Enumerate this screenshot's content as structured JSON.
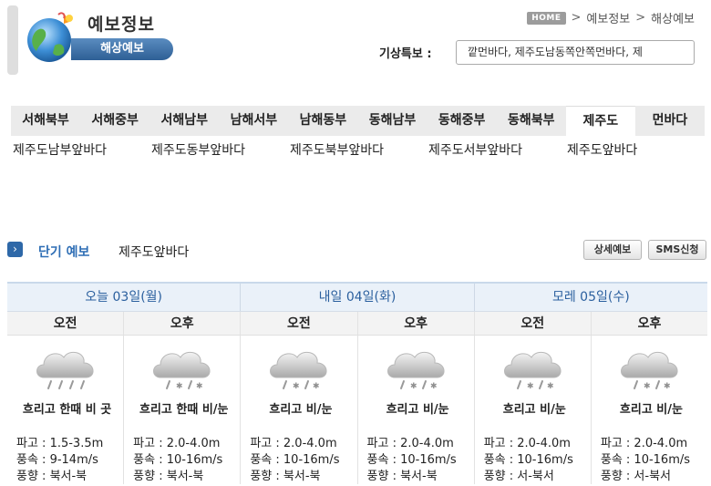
{
  "header": {
    "title": "예보정보",
    "subtitle": "해상예보",
    "breadcrumb": {
      "home": "HOME",
      "items": [
        "예보정보",
        "해상예보"
      ],
      "separator": ">"
    },
    "warning_label": "기상특보 :",
    "warning_text": "깥먼바다, 제주도남동쪽안쪽먼바다, 제"
  },
  "region_tabs": [
    {
      "label": "서해북부",
      "active": false
    },
    {
      "label": "서해중부",
      "active": false
    },
    {
      "label": "서해남부",
      "active": false
    },
    {
      "label": "남해서부",
      "active": false
    },
    {
      "label": "남해동부",
      "active": false
    },
    {
      "label": "동해남부",
      "active": false
    },
    {
      "label": "동해중부",
      "active": false
    },
    {
      "label": "동해북부",
      "active": false
    },
    {
      "label": "제주도",
      "active": true
    },
    {
      "label": "먼바다",
      "active": false
    }
  ],
  "sub_regions": [
    "제주도남부앞바다",
    "제주도동부앞바다",
    "제주도북부앞바다",
    "제주도서부앞바다",
    "제주도앞바다"
  ],
  "short_forecast": {
    "title": "단기 예보",
    "region": "제주도앞바다",
    "detail_button": "상세예보",
    "sms_button": "SMS신청"
  },
  "forecast": {
    "days": [
      "오늘 03일(월)",
      "내일 04일(화)",
      "모레 05일(수)"
    ],
    "halves": [
      "오전",
      "오후",
      "오전",
      "오후",
      "오전",
      "오후"
    ],
    "cells": [
      {
        "icon": "rain-cloud-icon",
        "weather": "흐리고 한때 비 곳",
        "wave": "파고 : 1.5-3.5m",
        "wind_speed": "풍속 : 9-14m/s",
        "wind_dir": "풍향 : 북서-북"
      },
      {
        "icon": "rain-snow-cloud-icon",
        "weather": "흐리고 한때 비/눈",
        "wave": "파고 : 2.0-4.0m",
        "wind_speed": "풍속 : 10-16m/s",
        "wind_dir": "풍향 : 북서-북"
      },
      {
        "icon": "rain-snow-cloud-icon",
        "weather": "흐리고 비/눈",
        "wave": "파고 : 2.0-4.0m",
        "wind_speed": "풍속 : 10-16m/s",
        "wind_dir": "풍향 : 북서-북"
      },
      {
        "icon": "rain-snow-cloud-icon",
        "weather": "흐리고 비/눈",
        "wave": "파고 : 2.0-4.0m",
        "wind_speed": "풍속 : 10-16m/s",
        "wind_dir": "풍향 : 북서-북"
      },
      {
        "icon": "rain-snow-cloud-icon",
        "weather": "흐리고 비/눈",
        "wave": "파고 : 2.0-4.0m",
        "wind_speed": "풍속 : 10-16m/s",
        "wind_dir": "풍향 : 서-북서"
      },
      {
        "icon": "rain-snow-cloud-icon",
        "weather": "흐리고 비/눈",
        "wave": "파고 : 2.0-4.0m",
        "wind_speed": "풍속 : 10-16m/s",
        "wind_dir": "풍향 : 서-북서"
      }
    ]
  },
  "colors": {
    "accent": "#2e6eb5",
    "badge": "#2e5f95",
    "tab_bg": "#ebebeb",
    "day_header_bg": "#eaf1f9"
  }
}
